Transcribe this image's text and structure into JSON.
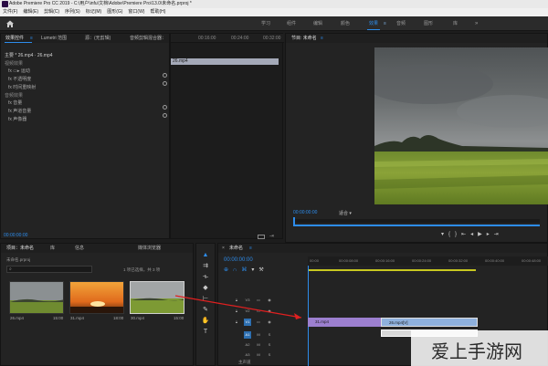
{
  "window": {
    "title": "Adobe Premiere Pro CC 2019 - C:\\用户\\infu\\文档\\Adobe\\Premiere Pro\\13.0\\未命名.prproj *"
  },
  "menu": [
    "文件(F)",
    "编辑(E)",
    "剪辑(C)",
    "序列(S)",
    "标记(M)",
    "图形(G)",
    "窗口(W)",
    "帮助(H)"
  ],
  "workspaces": [
    "学习",
    "组件",
    "编辑",
    "颜色",
    "效果",
    "音频",
    "图形",
    "库"
  ],
  "active_workspace": "效果",
  "effect_controls": {
    "tabs": [
      "效果控件",
      "Lumetri 范围",
      "源：(无剪辑)",
      "音频剪辑混合器："
    ],
    "clip_path": "主要 * 26.mp4 · 26.mp4",
    "video_effects_header": "视频效果",
    "rows": [
      "fx ▭▸ 运动",
      "fx 不透明度",
      "fx 时间重映射"
    ],
    "audio_effects_header": "音频效果",
    "audio_rows": [
      "fx 音量",
      "fx 声道音量",
      "fx 声像器"
    ],
    "timecodes": [
      "00:16:00",
      "00:24:00",
      "00:32:00"
    ],
    "clip_chip": "26.mp4",
    "current_time": "00:00:00:00"
  },
  "program_monitor": {
    "tab": "节目: 未命名",
    "timecode": "00:00:00:00",
    "fit": "适合",
    "icons": [
      "marker-icon",
      "in-point-icon",
      "out-point-icon",
      "go-to-in-icon",
      "step-back-icon",
      "play-icon",
      "step-forward-icon",
      "go-to-out-icon",
      "lift-icon",
      "extract-icon",
      "export-frame-icon"
    ]
  },
  "project": {
    "tabs": [
      "项目：未命名",
      "库",
      "信息",
      "媒体浏览器"
    ],
    "name_row": "未命名.prproj",
    "selection": "1 项已选择，共 3 项",
    "items": [
      {
        "name": "26.mp4",
        "duration": "15:00"
      },
      {
        "name": "31.mp4",
        "duration": "18:00"
      },
      {
        "name": "30.mp4",
        "duration": "15:00"
      }
    ]
  },
  "timeline": {
    "tab": "未命名",
    "timecode": "00:00:00:00",
    "ruler": [
      "00:00",
      "00:00:08:00",
      "00:00:16:00",
      "00:00:24:00",
      "00:00:32:00",
      "00:00:40:00",
      "00:00:48:00"
    ],
    "tracks": [
      "V3",
      "V2",
      "V1",
      "A1",
      "A2",
      "A3"
    ],
    "clips": [
      {
        "name": "31.mp4",
        "track": "V1",
        "color": "#9c7fcf"
      },
      {
        "name": "26.mp4[V]",
        "track": "V1",
        "color": "#8fb1dd"
      }
    ],
    "mix": "主声道"
  },
  "watermark": "爱上手游网"
}
